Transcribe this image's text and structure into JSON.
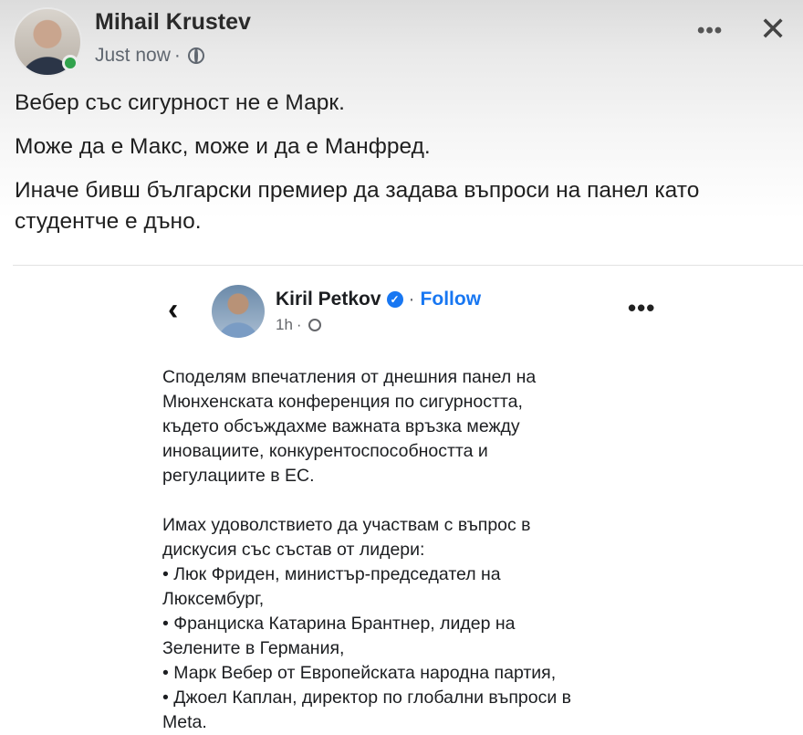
{
  "post": {
    "author": "Mihail Krustev",
    "time": "Just now",
    "separator": "·",
    "more": "•••",
    "close": "✕",
    "paragraphs": [
      "Вебер със сигурност не е Марк.",
      "Може да е Макс, може и да е Манфред.",
      "Иначе бивш български премиер да задава въпроси на панел като студентче е дъно."
    ]
  },
  "embed": {
    "back": "‹",
    "author": "Kiril Petkov",
    "verified": "✓",
    "separator": "·",
    "follow": "Follow",
    "time": "1h",
    "time_separator": "·",
    "more": "•••",
    "paragraph1_lines": [
      "Споделям впечатления от днешния панел на",
      "Мюнхенската конференция по сигурността,",
      "където обсъждахме важната връзка между",
      "иновациите, конкурентоспособността и",
      "регулациите в ЕС."
    ],
    "paragraph2_lines": [
      "Имах удоволствието да участвам с въпрос в",
      "дискусия със състав от лидери:",
      "• Люк Фриден, министър-председател на",
      "Люксембург,",
      "• Франциска Катарина Брантнер, лидер на",
      "Зелените в Германия,",
      "• Марк Вебер от Европейската народна партия,",
      "• Джоел Каплан, директор по глобални въпроси в",
      "Meta."
    ]
  },
  "colors": {
    "accent": "#1877f2",
    "online": "#31a24c"
  },
  "icons": [
    "globe-icon",
    "more-icon",
    "close-icon",
    "back-icon",
    "verified-icon"
  ]
}
